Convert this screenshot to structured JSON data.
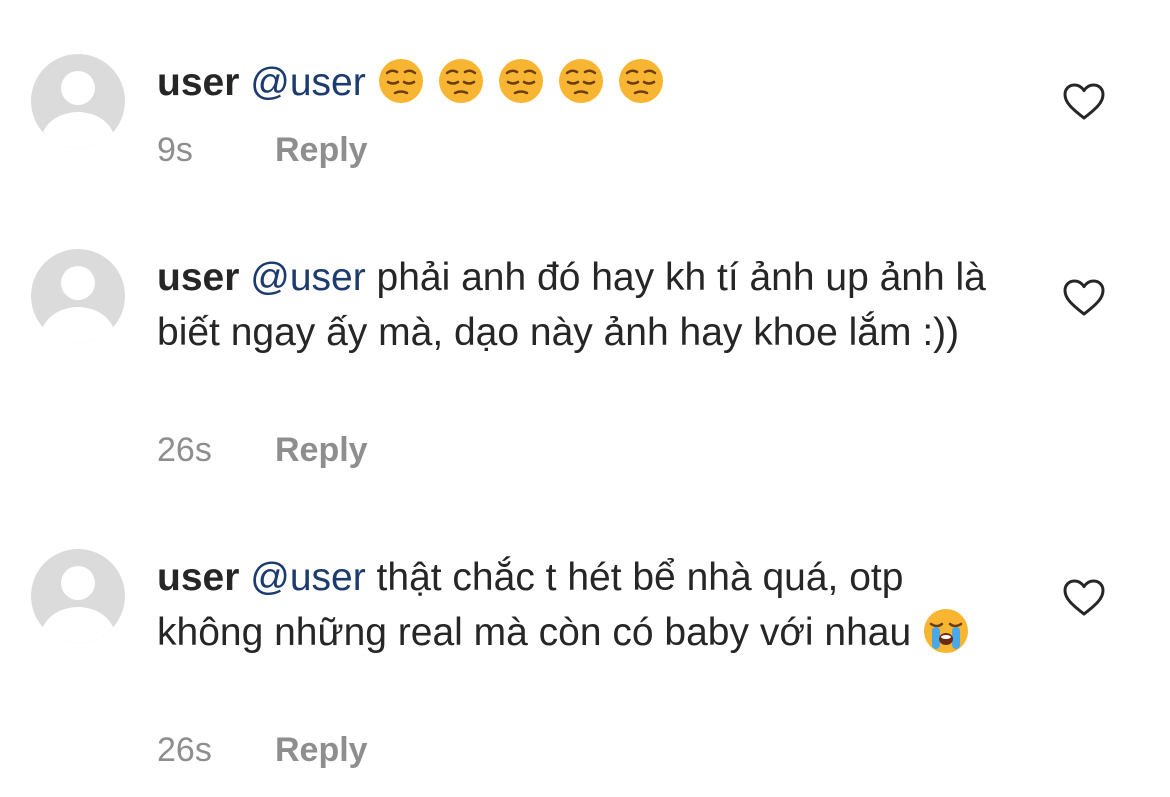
{
  "comments": [
    {
      "username": "user",
      "mention": "@user",
      "text": "",
      "emojis": [
        "pensive-face",
        "pensive-face",
        "pensive-face",
        "pensive-face",
        "pensive-face"
      ],
      "time": "9s",
      "reply": "Reply"
    },
    {
      "username": "user",
      "mention": "@user",
      "text": "phải anh đó hay kh tí ảnh up ảnh là biết ngay ấy mà, dạo này ảnh hay khoe lắm :))",
      "time": "26s",
      "reply": "Reply"
    },
    {
      "username": "user",
      "mention": "@user",
      "text": "thật chắc t hét bể nhà quá, otp không những real mà còn có baby với nhau",
      "emojis": [
        "loudly-crying-face"
      ],
      "time": "26s",
      "reply": "Reply"
    }
  ],
  "colors": {
    "mention": "#1c3b6e",
    "meta": "#8e8e8e",
    "avatar": "#dbdbdb",
    "heart": "#262626"
  }
}
